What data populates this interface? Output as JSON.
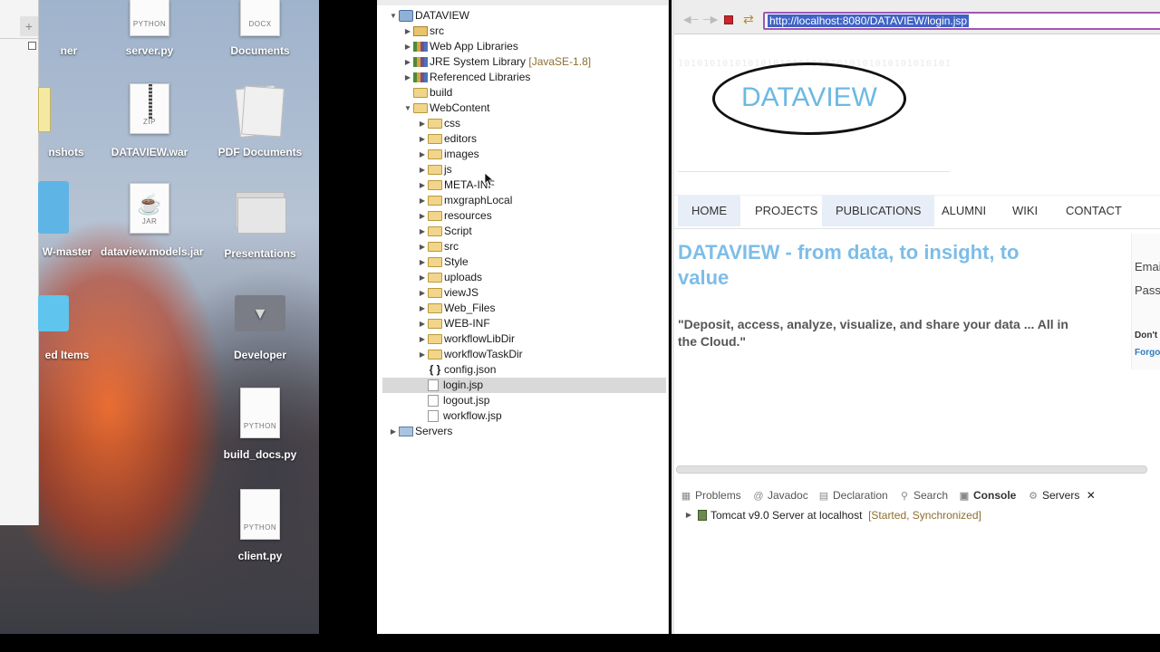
{
  "desktop": {
    "items": [
      {
        "label": "ner",
        "tag": ""
      },
      {
        "label": "server.py",
        "tag": "PYTHON"
      },
      {
        "label": "Documents",
        "tag": "DOCX"
      },
      {
        "label": "nshots",
        "tag": ""
      },
      {
        "label": "DATAVIEW.war",
        "tag": "ZIP"
      },
      {
        "label": "PDF Documents",
        "tag": ""
      },
      {
        "label": "W-master",
        "tag": ""
      },
      {
        "label": "dataview.models.jar",
        "tag": "JAR"
      },
      {
        "label": "Presentations",
        "tag": ""
      },
      {
        "label": "ed Items",
        "tag": ""
      },
      {
        "label": "Developer",
        "tag": ""
      },
      {
        "label": "build_docs.py",
        "tag": "PYTHON"
      },
      {
        "label": "client.py",
        "tag": "PYTHON"
      }
    ]
  },
  "explorer": {
    "tree": [
      {
        "label": "DATAVIEW",
        "decor": ""
      },
      {
        "label": "src",
        "decor": ""
      },
      {
        "label": "Web App Libraries",
        "decor": ""
      },
      {
        "label": "JRE System Library",
        "decor": "[JavaSE-1.8]"
      },
      {
        "label": "Referenced Libraries",
        "decor": ""
      },
      {
        "label": "build",
        "decor": ""
      },
      {
        "label": "WebContent",
        "decor": ""
      },
      {
        "label": "css",
        "decor": ""
      },
      {
        "label": "editors",
        "decor": ""
      },
      {
        "label": "images",
        "decor": ""
      },
      {
        "label": "js",
        "decor": ""
      },
      {
        "label": "META-INF",
        "decor": ""
      },
      {
        "label": "mxgraphLocal",
        "decor": ""
      },
      {
        "label": "resources",
        "decor": ""
      },
      {
        "label": "Script",
        "decor": ""
      },
      {
        "label": "src",
        "decor": ""
      },
      {
        "label": "Style",
        "decor": ""
      },
      {
        "label": "uploads",
        "decor": ""
      },
      {
        "label": "viewJS",
        "decor": ""
      },
      {
        "label": "Web_Files",
        "decor": ""
      },
      {
        "label": "WEB-INF",
        "decor": ""
      },
      {
        "label": "workflowLibDir",
        "decor": ""
      },
      {
        "label": "workflowTaskDir",
        "decor": ""
      },
      {
        "label": "config.json",
        "decor": ""
      },
      {
        "label": "login.jsp",
        "decor": ""
      },
      {
        "label": "logout.jsp",
        "decor": ""
      },
      {
        "label": "workflow.jsp",
        "decor": ""
      },
      {
        "label": "Servers",
        "decor": ""
      }
    ],
    "selected": "login.jsp"
  },
  "browser": {
    "url": "http://localhost:8080/DATAVIEW/login.jsp",
    "logo_text": "DATAVIEW",
    "logo_bg_digits": "1010101010101010101010101010101010101010101010101010101010101010101010101010101010101010101010101010101010111",
    "nav": [
      "HOME",
      "PROJECTS",
      "PUBLICATIONS",
      "ALUMNI",
      "WIKI",
      "CONTACT"
    ],
    "hero_title": "DATAVIEW - from data, to insight, to value",
    "hero_quote": "\"Deposit, access, analyze, visualize, and share your data ... All in the Cloud.\"",
    "side_form": {
      "email_label": "Emai",
      "password_label": "Passv",
      "dont_label": "Don't",
      "forgot_label": "Forgo"
    }
  },
  "panel": {
    "tabs": [
      "Problems",
      "Javadoc",
      "Declaration",
      "Search",
      "Console",
      "Servers"
    ],
    "server_name": "Tomcat v9.0 Server at localhost",
    "server_status": "[Started, Synchronized]"
  },
  "colors": {
    "accent_blue": "#7dbde8",
    "logo_blue": "#6bb9e3",
    "url_border": "#a356b4",
    "selection": "#d9d9d9"
  }
}
